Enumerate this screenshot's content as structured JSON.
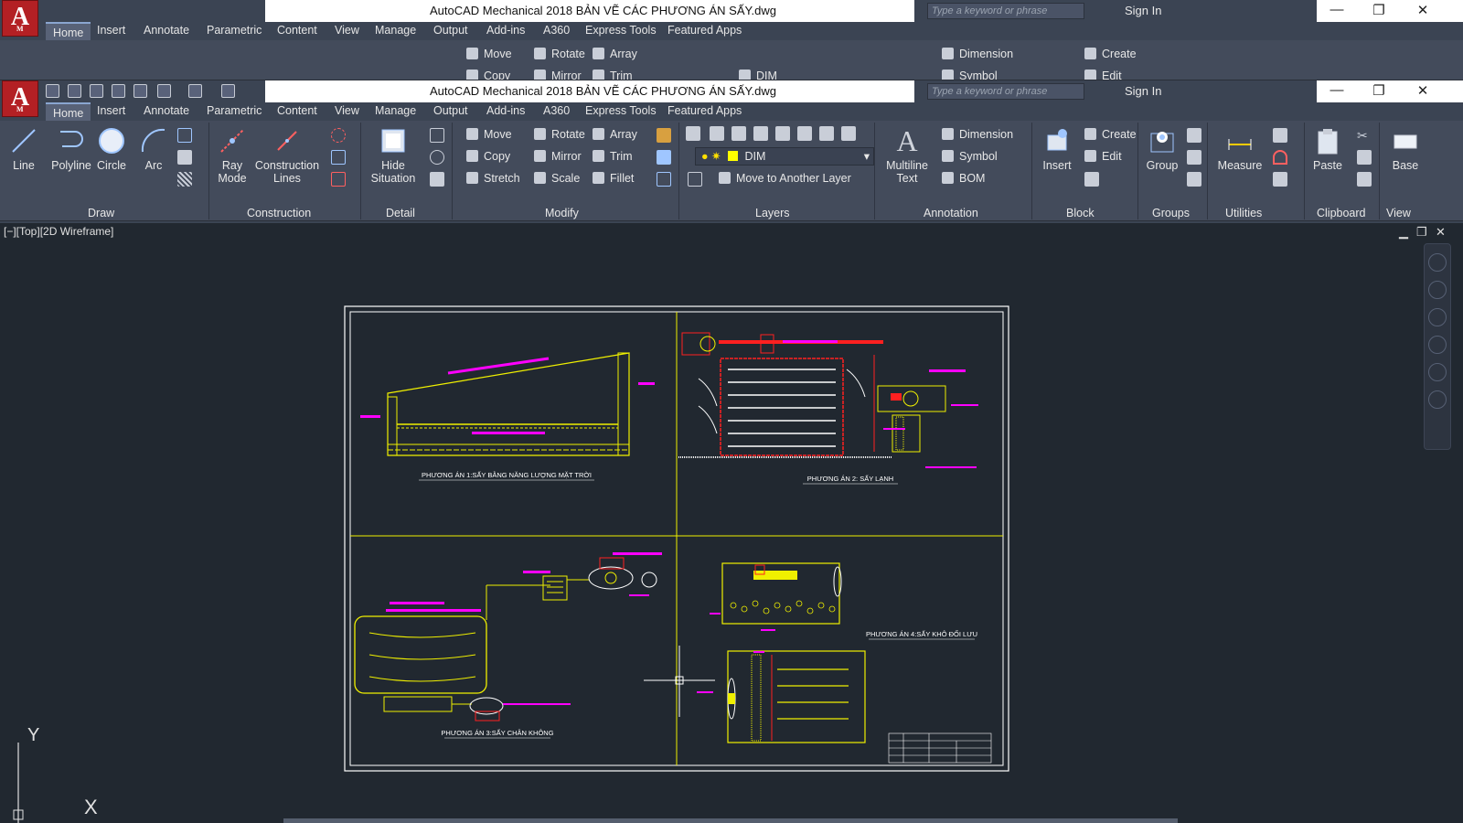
{
  "window": {
    "title": "AutoCAD Mechanical 2018    BẢN VẼ CÁC PHƯƠNG ÁN SẤY.dwg",
    "search_placeholder": "Type a keyword or phrase",
    "signin": "Sign In"
  },
  "app_logo": {
    "letter": "A",
    "sub": "M"
  },
  "tabs": [
    "Home",
    "Insert",
    "Annotate",
    "Parametric",
    "Content",
    "View",
    "Manage",
    "Output",
    "Add-ins",
    "A360",
    "Express Tools",
    "Featured Apps"
  ],
  "ribbon": {
    "draw": {
      "label": "Draw",
      "line": "Line",
      "polyline": "Polyline",
      "circle": "Circle",
      "arc": "Arc"
    },
    "construction": {
      "label": "Construction",
      "ray_mode_1": "Ray",
      "ray_mode_2": "Mode",
      "construction_lines_1": "Construction",
      "construction_lines_2": "Lines"
    },
    "detail": {
      "label": "Detail",
      "hide_1": "Hide",
      "hide_2": "Situation"
    },
    "modify": {
      "label": "Modify",
      "move": "Move",
      "rotate": "Rotate",
      "array": "Array",
      "copy": "Copy",
      "mirror": "Mirror",
      "trim": "Trim",
      "stretch": "Stretch",
      "scale": "Scale",
      "fillet": "Fillet"
    },
    "layers": {
      "label": "Layers",
      "current": "DIM",
      "move_layer": "Move to Another Layer"
    },
    "annotation": {
      "label": "Annotation",
      "mtext_1": "Multiline",
      "mtext_2": "Text",
      "dimension": "Dimension",
      "symbol": "Symbol",
      "bom": "BOM"
    },
    "block": {
      "label": "Block",
      "insert": "Insert",
      "create": "Create",
      "edit": "Edit"
    },
    "groups": {
      "label": "Groups",
      "group": "Group"
    },
    "utilities": {
      "label": "Utilities",
      "measure": "Measure"
    },
    "clipboard": {
      "label": "Clipboard",
      "paste": "Paste"
    },
    "view": {
      "label": "View",
      "base": "Base"
    }
  },
  "viewport": {
    "label": "[−][Top][2D Wireframe]",
    "axis_y": "Y",
    "axis_x": "X"
  },
  "drawing": {
    "q1_caption": "PHƯƠNG ÁN 1:SẤY BẰNG NĂNG LƯỢNG MẶT TRỜI",
    "q2_caption": "PHƯƠNG ÁN 2: SẤY LẠNH",
    "q3_caption": "PHƯƠNG ÁN 3:SẤY CHÂN KHÔNG",
    "q4_caption": "PHƯƠNG ÁN 4:SẤY KHÔ ĐỐI LƯU"
  },
  "colors": {
    "yellow": "#f0f000",
    "magenta": "#ff00ff",
    "red": "#ff2020",
    "white": "#ffffff",
    "bg": "#212830"
  }
}
